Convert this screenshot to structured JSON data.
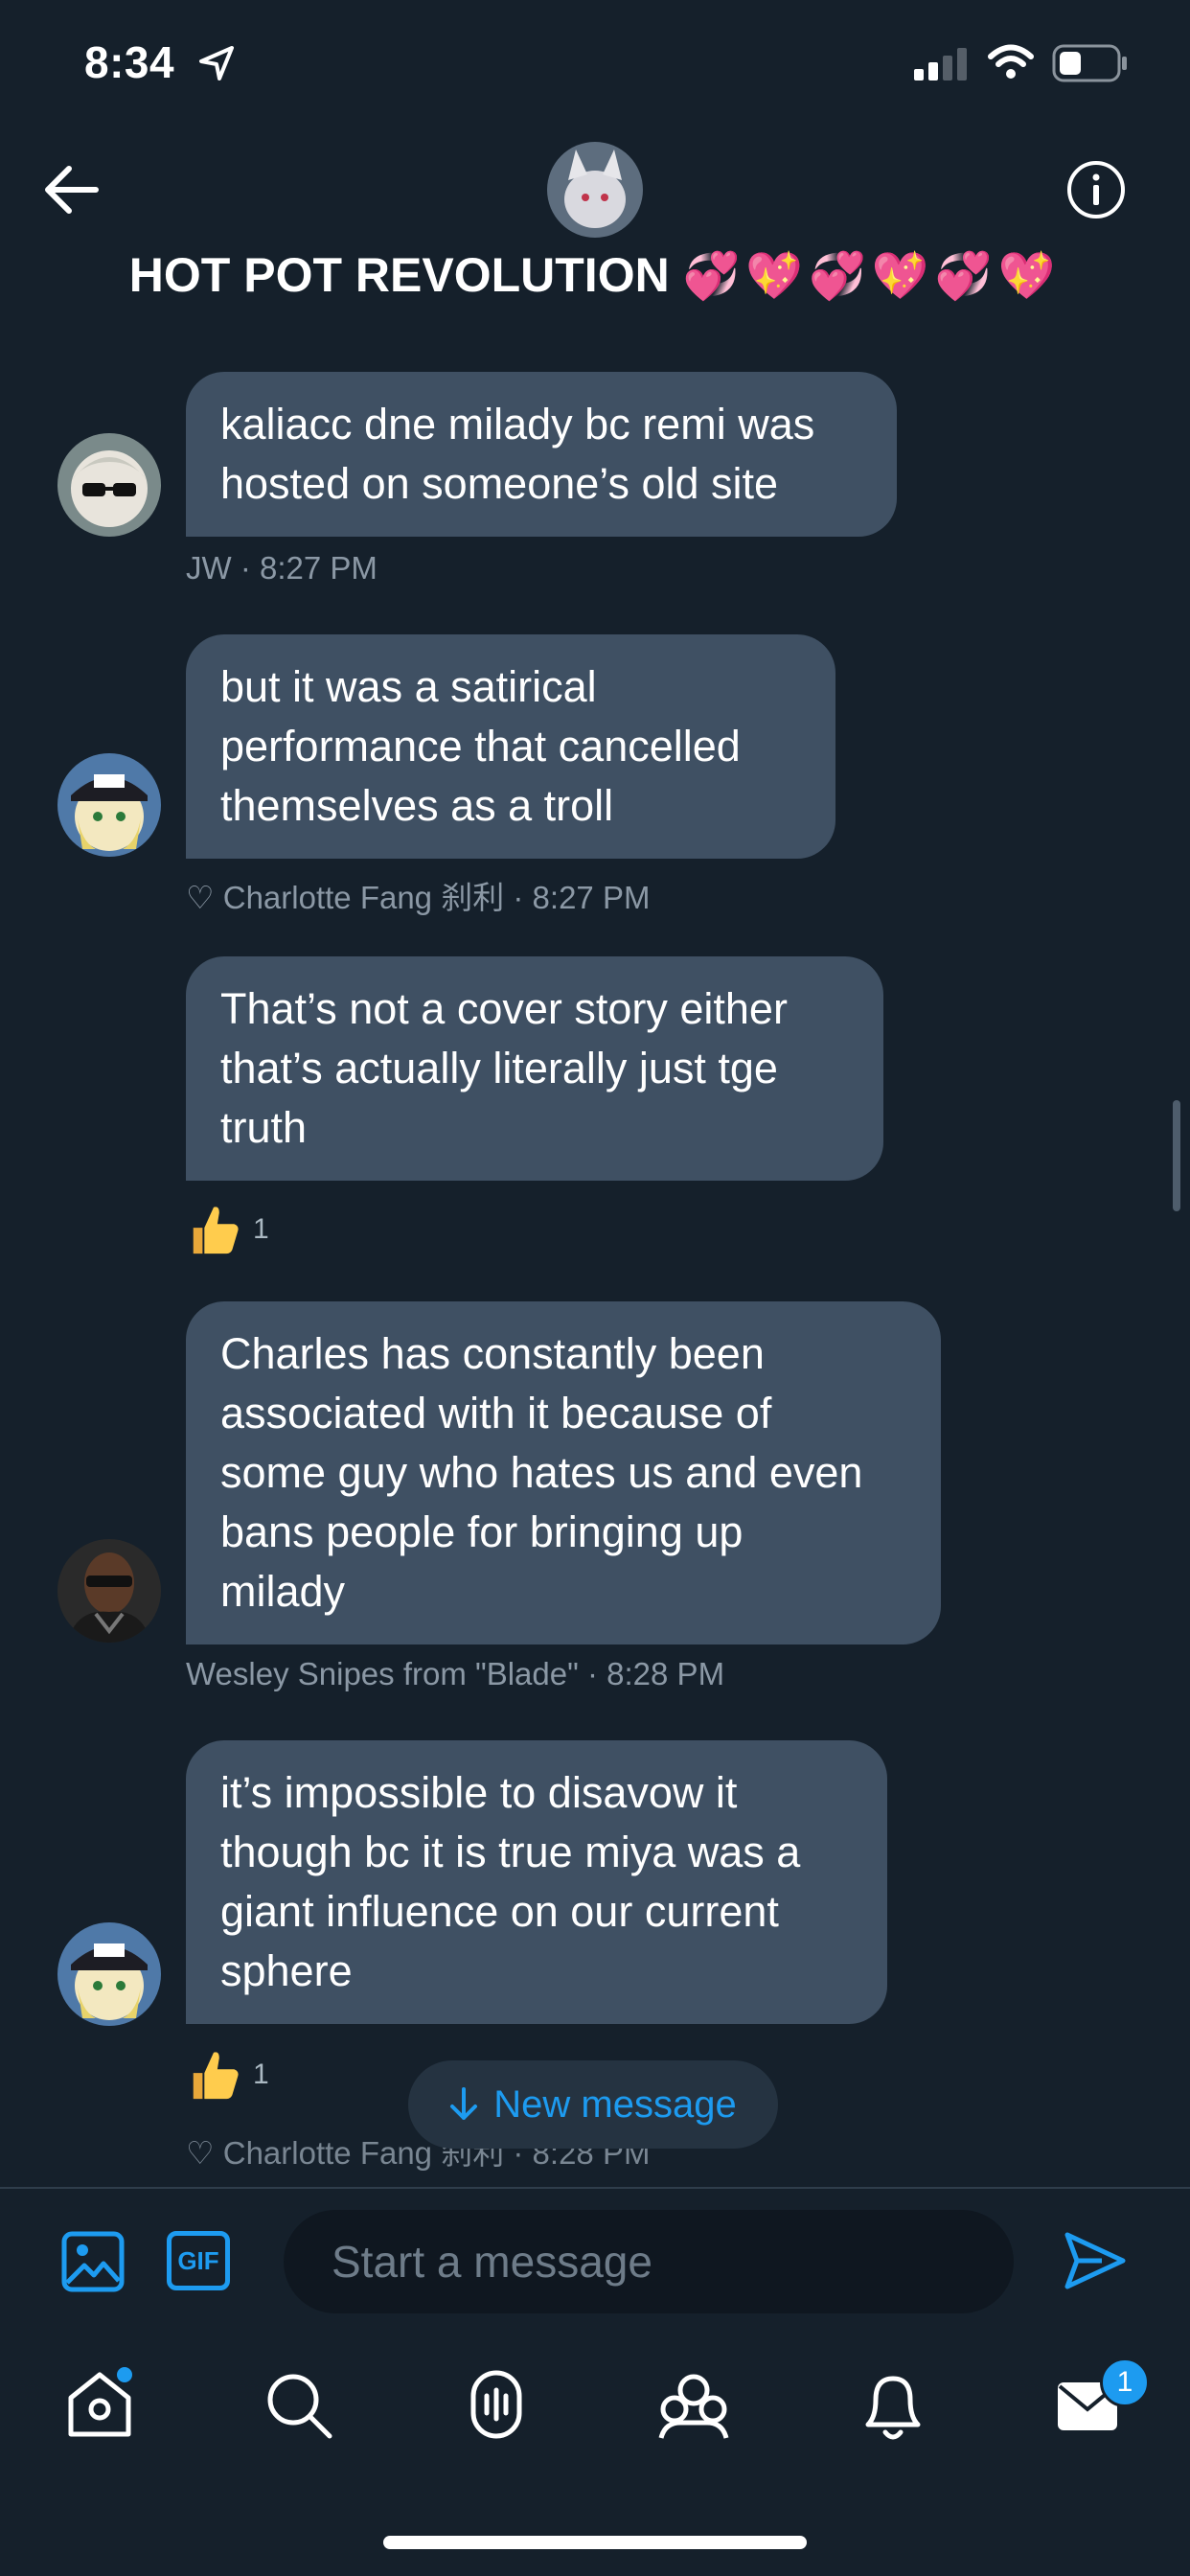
{
  "status_bar": {
    "time": "8:34"
  },
  "header": {
    "title": "HOT POT REVOLUTION",
    "emoji": "💞💖💞💖💞💖"
  },
  "messages": [
    {
      "lines": [
        "kaliacc dne milady bc remi was",
        "hosted on someone’s old site"
      ],
      "sender": "JW",
      "time": "· 8:27 PM"
    },
    {
      "lines": [
        "but it was a satirical",
        "performance that cancelled",
        "themselves as a troll"
      ],
      "sender": "♡ Charlotte Fang 刹利",
      "time": "· 8:27 PM"
    },
    {
      "lines": [
        "That’s not a cover story either",
        "that’s actually literally just tge",
        "truth"
      ],
      "reaction_count": "1"
    },
    {
      "lines": [
        "Charles has constantly been",
        "associated with it because of",
        "some guy who hates us and even",
        "bans people for bringing up",
        "milady"
      ],
      "sender": "Wesley Snipes from \"Blade\"",
      "time": "· 8:28 PM"
    },
    {
      "lines": [
        "it’s impossible to disavow it",
        "though bc it is true miya was a",
        "giant influence on our current",
        "sphere"
      ],
      "reaction_count": "1",
      "sender": "♡ Charlotte Fang 刹利",
      "time": "· 8:28 PM"
    }
  ],
  "new_message_label": "New message",
  "composer": {
    "placeholder": "Start a message",
    "gif_label": "GIF"
  },
  "nav": {
    "messages_badge": "1"
  },
  "colors": {
    "background": "#15202b",
    "bubble": "#3f5063",
    "accent": "#1d9bf0"
  }
}
